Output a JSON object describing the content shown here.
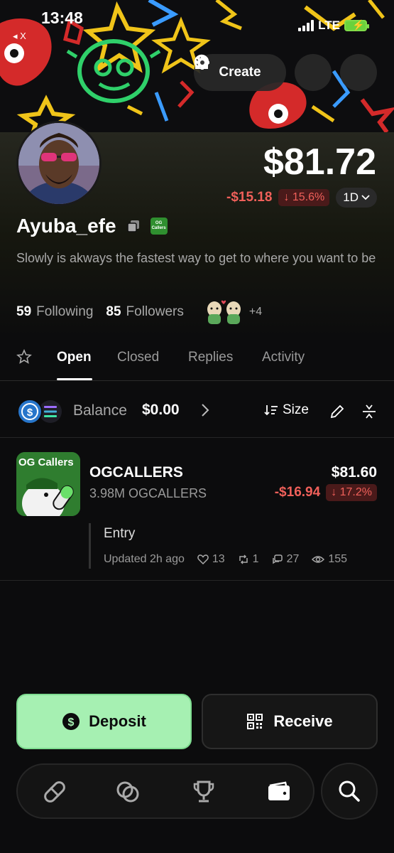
{
  "status_bar": {
    "time": "13:48",
    "back_app": "◂ X",
    "network": "LTE"
  },
  "header": {
    "create_label": "Create"
  },
  "profile": {
    "total_value": "$81.72",
    "change_amount": "-$15.18",
    "change_pct": "↓ 15.6%",
    "range": "1D",
    "username": "Ayuba_efe",
    "badge_label": "OG Callers",
    "bio": "Slowly is akways the fastest way to get to where you want to be",
    "following_count": "59",
    "following_label": "Following",
    "followers_count": "85",
    "followers_label": "Followers",
    "extra_followers": "+4"
  },
  "tabs": [
    {
      "label": "Open"
    },
    {
      "label": "Closed"
    },
    {
      "label": "Replies"
    },
    {
      "label": "Activity"
    }
  ],
  "balance": {
    "label": "Balance",
    "value": "$0.00",
    "size_label": "Size"
  },
  "positions": [
    {
      "image_label": "OG Callers",
      "name": "OGCALLERS",
      "quantity": "3.98M OGCALLERS",
      "value": "$81.60",
      "change_amount": "-$16.94",
      "change_pct": "↓ 17.2%",
      "note": "Entry",
      "updated": "Updated 2h ago",
      "likes": "13",
      "reposts": "1",
      "comments": "27",
      "views": "155"
    }
  ],
  "actions": {
    "deposit_label": "Deposit",
    "receive_label": "Receive"
  },
  "colors": {
    "accent_green": "#a6f0b2",
    "negative": "#f0605a"
  }
}
